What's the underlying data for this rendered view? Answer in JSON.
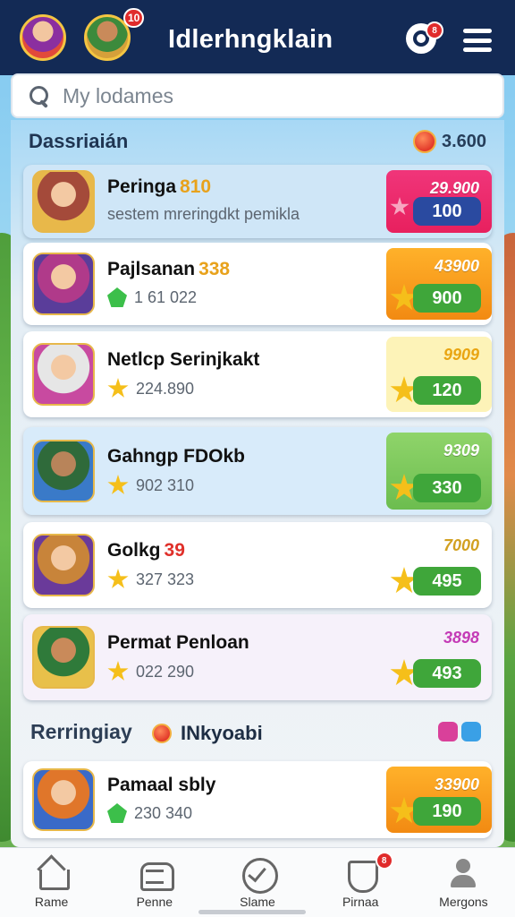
{
  "header": {
    "title": "Idlerhngklain",
    "avatar_badge": "10",
    "coin_badge": "8"
  },
  "search": {
    "placeholder": "My lodames"
  },
  "section": {
    "title": "Dassriaián",
    "points": "3.600"
  },
  "rows": [
    {
      "name": "Peringa",
      "tag": "810",
      "sub": "sestem mreringdkt pemikla",
      "top": "29.900",
      "score": "100",
      "style": "pink"
    },
    {
      "name": "Pajlsanan",
      "tag": "338",
      "sub": "1 61 022",
      "top": "43900",
      "score": "900",
      "style": "orange"
    },
    {
      "name": "Netlcp Serinjkakt",
      "tag": "",
      "sub": "224.890",
      "top": "9909",
      "score": "120",
      "style": "yellow"
    },
    {
      "name": "Gahngp FDOkb",
      "tag": "",
      "sub": "902 310",
      "top": "9309",
      "score": "330",
      "style": "green"
    },
    {
      "name": "Golkg",
      "tag": "39",
      "sub": "327 323",
      "top": "7000",
      "score": "495",
      "style": "white"
    },
    {
      "name": "Permat Penloan",
      "tag": "",
      "sub": "022 290",
      "top": "3898",
      "score": "493",
      "style": "purple"
    },
    {
      "name": "Pamaal sbly",
      "tag": "",
      "sub": "230 340",
      "top": "33900",
      "score": "190",
      "style": "orange"
    }
  ],
  "section2": {
    "title": "Rerringiay",
    "badge_label": "INkyoabi"
  },
  "nav": {
    "items": [
      {
        "label": "Rame"
      },
      {
        "label": "Penne"
      },
      {
        "label": "Slame"
      },
      {
        "label": "Pirnaa",
        "badge": "8"
      },
      {
        "label": "Mergons"
      }
    ]
  }
}
